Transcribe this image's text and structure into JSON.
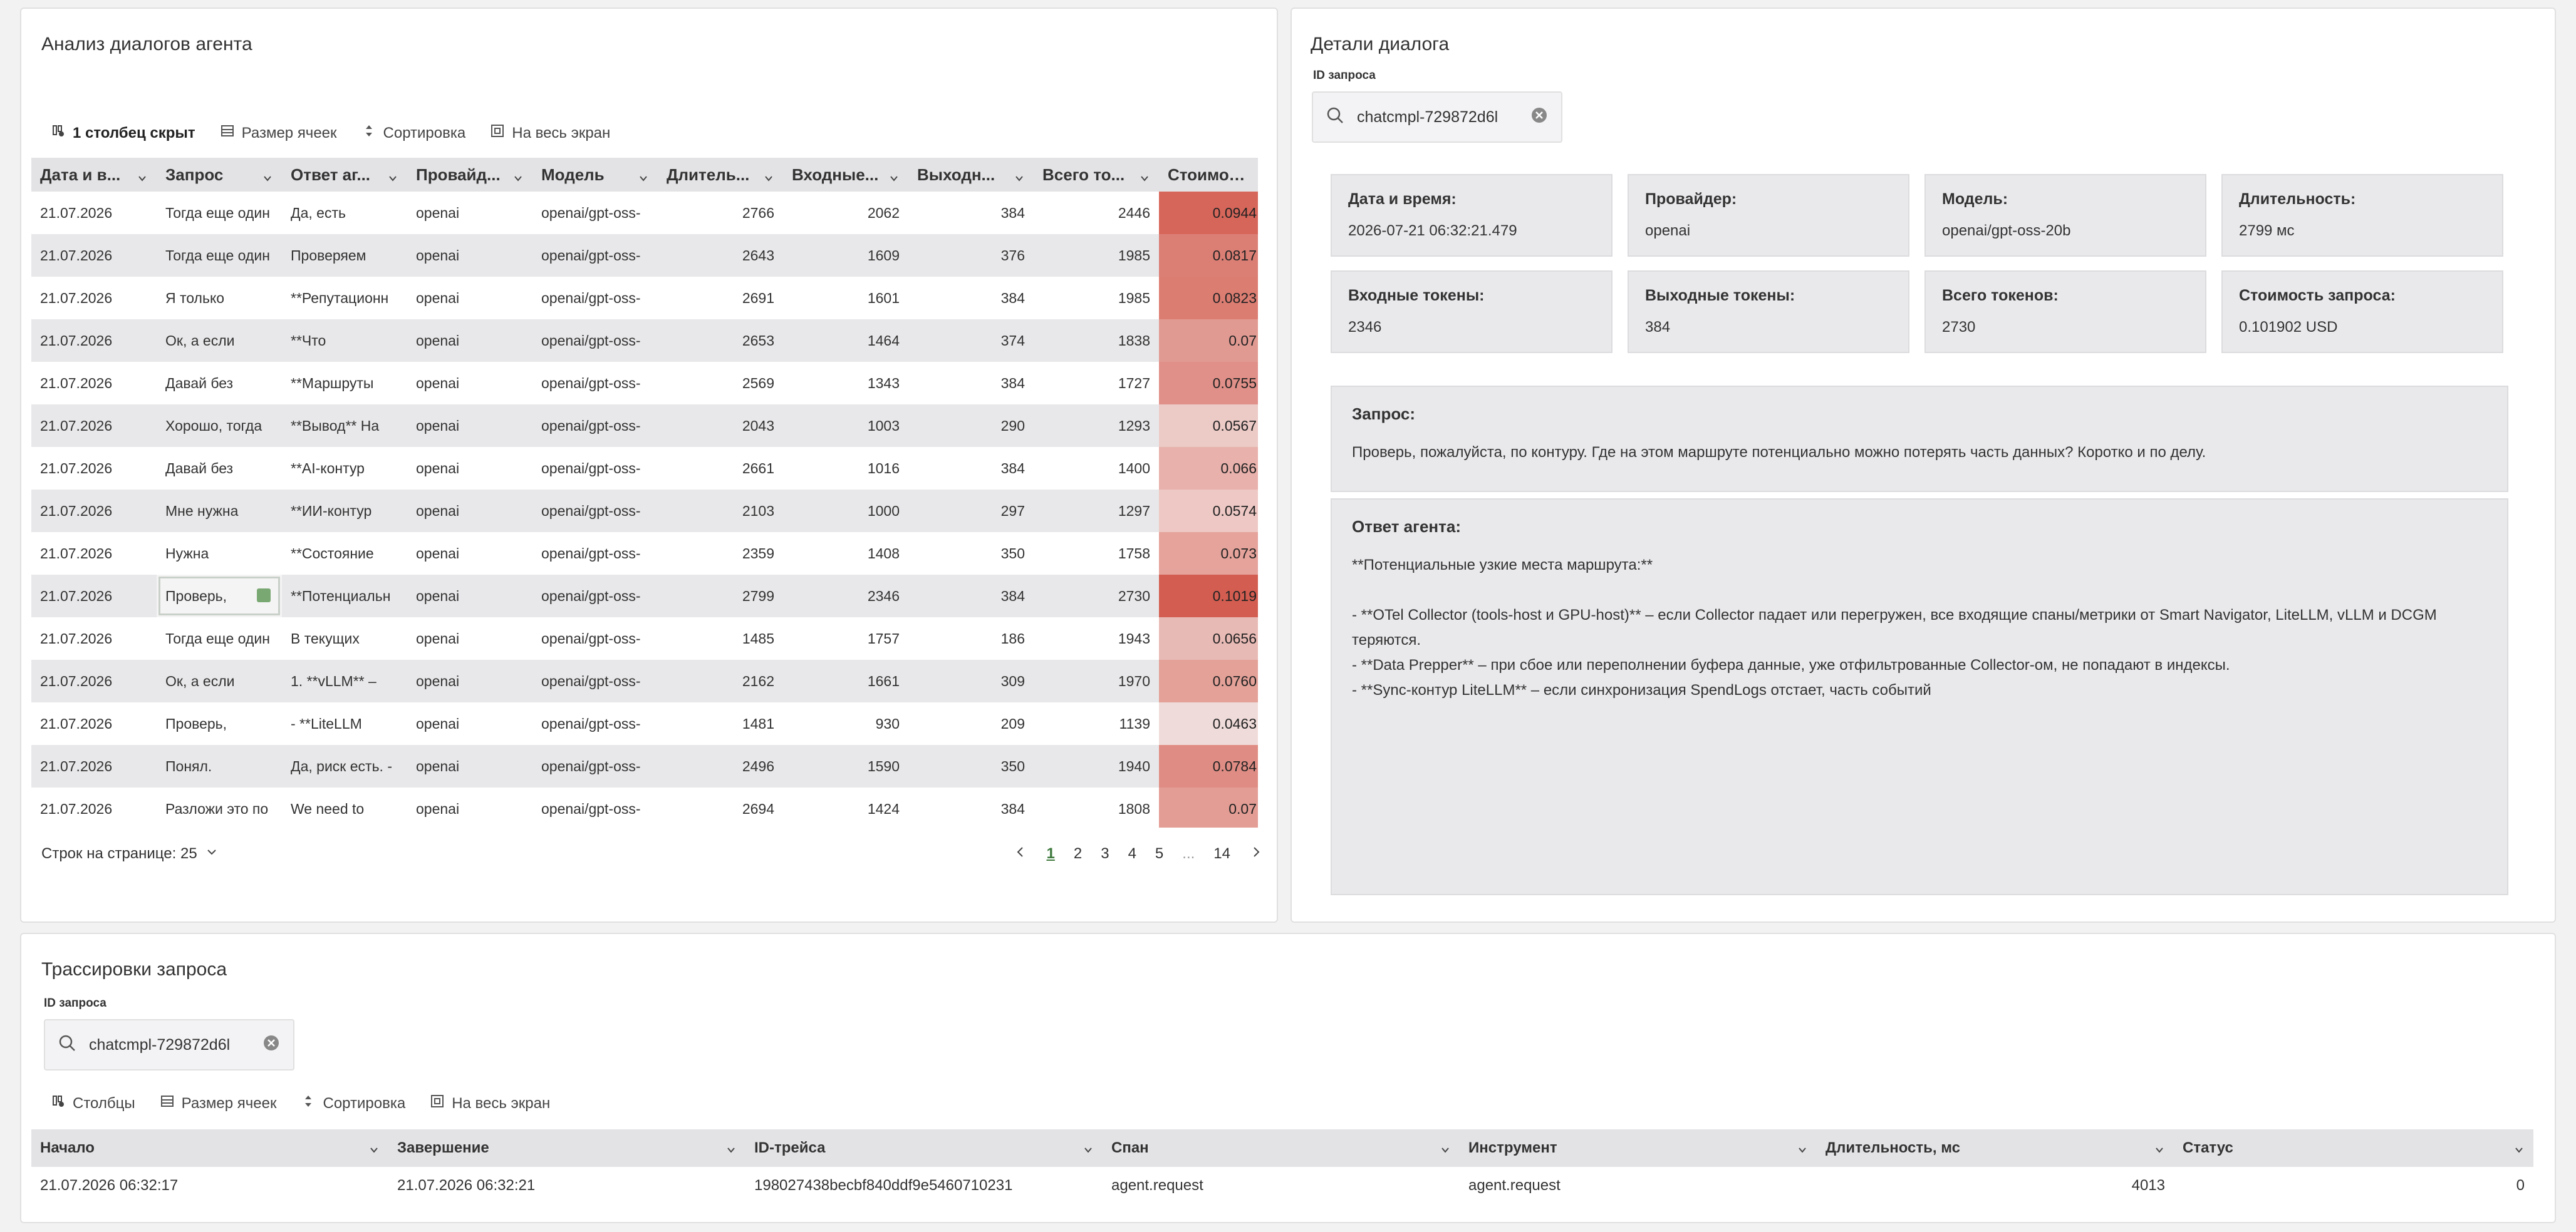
{
  "analysis": {
    "title": "Анализ диалогов агента",
    "toolbar": {
      "hidden_cols": "1 столбец скрыт",
      "cell_size": "Размер ячеек",
      "sort": "Сортировка",
      "fullscreen": "На весь экран"
    },
    "columns": [
      "Дата и в...",
      "Запрос",
      "Ответ аг...",
      "Провайд...",
      "Модель",
      "Длитель...",
      "Входные...",
      "Выходн...",
      "Всего то...",
      "Стоимос..."
    ],
    "rows": [
      [
        "21.07.2026",
        "Тогда еще один",
        "Да, есть",
        "openai",
        "openai/gpt-oss-",
        "2766",
        "2062",
        "384",
        "2446",
        "0.0944"
      ],
      [
        "21.07.2026",
        "Тогда еще один",
        "Проверяем",
        "openai",
        "openai/gpt-oss-",
        "2643",
        "1609",
        "376",
        "1985",
        "0.0817"
      ],
      [
        "21.07.2026",
        "Я только",
        "**Репутационн",
        "openai",
        "openai/gpt-oss-",
        "2691",
        "1601",
        "384",
        "1985",
        "0.0823"
      ],
      [
        "21.07.2026",
        "Ок, а если",
        "**Что",
        "openai",
        "openai/gpt-oss-",
        "2653",
        "1464",
        "374",
        "1838",
        "0.07"
      ],
      [
        "21.07.2026",
        "Давай без",
        "**Маршруты",
        "openai",
        "openai/gpt-oss-",
        "2569",
        "1343",
        "384",
        "1727",
        "0.0755"
      ],
      [
        "21.07.2026",
        "Хорошо, тогда",
        "**Вывод** На",
        "openai",
        "openai/gpt-oss-",
        "2043",
        "1003",
        "290",
        "1293",
        "0.0567"
      ],
      [
        "21.07.2026",
        "Давай без",
        "**AI-контур",
        "openai",
        "openai/gpt-oss-",
        "2661",
        "1016",
        "384",
        "1400",
        "0.066"
      ],
      [
        "21.07.2026",
        "Мне нужна",
        "**ИИ-контур",
        "openai",
        "openai/gpt-oss-",
        "2103",
        "1000",
        "297",
        "1297",
        "0.0574"
      ],
      [
        "21.07.2026",
        "Нужна",
        "**Состояние",
        "openai",
        "openai/gpt-oss-",
        "2359",
        "1408",
        "350",
        "1758",
        "0.073"
      ],
      [
        "21.07.2026",
        "Проверь,",
        "**Потенциальн",
        "openai",
        "openai/gpt-oss-",
        "2799",
        "2346",
        "384",
        "2730",
        "0.1019"
      ],
      [
        "21.07.2026",
        "Тогда еще один",
        "В текущих",
        "openai",
        "openai/gpt-oss-",
        "1485",
        "1757",
        "186",
        "1943",
        "0.0656"
      ],
      [
        "21.07.2026",
        "Ок, а если",
        "1. **vLLM** –",
        "openai",
        "openai/gpt-oss-",
        "2162",
        "1661",
        "309",
        "1970",
        "0.0760"
      ],
      [
        "21.07.2026",
        "Проверь,",
        "- **LiteLLM",
        "openai",
        "openai/gpt-oss-",
        "1481",
        "930",
        "209",
        "1139",
        "0.0463"
      ],
      [
        "21.07.2026",
        "Понял.",
        "Да, риск есть. -",
        "openai",
        "openai/gpt-oss-",
        "2496",
        "1590",
        "350",
        "1940",
        "0.0784"
      ],
      [
        "21.07.2026",
        "Разложи это по",
        "We need to",
        "openai",
        "openai/gpt-oss-",
        "2694",
        "1424",
        "384",
        "1808",
        "0.07"
      ]
    ],
    "cost_colors": [
      "#d7665a",
      "#db7f75",
      "#dc7d72",
      "#e19a92",
      "#e09088",
      "#eccac6",
      "#e8b1ab",
      "#edc8c4",
      "#e5a39b",
      "#d35d50",
      "#e8bab5",
      "#e3a198",
      "#efdcda",
      "#df8d84",
      "#e39d95"
    ],
    "selected_row": 9,
    "footer": {
      "rows_per_page": "Строк на странице: 25",
      "pages": [
        "1",
        "2",
        "3",
        "4",
        "5",
        "...",
        "14"
      ],
      "active_page": "1"
    }
  },
  "details": {
    "title": "Детали диалога",
    "request_id_label": "ID запроса",
    "request_id_value": "chatcmpl-729872d6l",
    "cards": [
      {
        "label": "Дата и время:",
        "value": "2026-07-21 06:32:21.479"
      },
      {
        "label": "Провайдер:",
        "value": "openai"
      },
      {
        "label": "Модель:",
        "value": "openai/gpt-oss-20b"
      },
      {
        "label": "Длительность:",
        "value": "2799 мс"
      },
      {
        "label": "Входные токены:",
        "value": "2346"
      },
      {
        "label": "Выходные токены:",
        "value": "384"
      },
      {
        "label": "Всего токенов:",
        "value": "2730"
      },
      {
        "label": "Стоимость запроса:",
        "value": "0.101902 USD"
      }
    ],
    "request_label": "Запрос:",
    "request_text": "Проверь, пожалуйста, по контуру. Где на этом маршруте потенциально можно потерять часть данных? Коротко и по делу.",
    "answer_label": "Ответ агента:",
    "answer_lines": [
      "**Потенциальные узкие места маршрута:**",
      "",
      "- **OTel Collector (tools-host и GPU-host)** – если Collector падает или перегружен, все входящие спаны/метрики от Smart Navigator, LiteLLM, vLLM и DCGM теряются.",
      "- **Data Prepper** – при сбое или переполнении буфера данные, уже отфильтрованные Collector-ом, не попадают в индексы.",
      "- **Sync-контур LiteLLM** – если синхронизация SpendLogs отстает, часть событий"
    ]
  },
  "traces": {
    "title": "Трассировки запроса",
    "request_id_label": "ID запроса",
    "request_id_value": "chatcmpl-729872d6l",
    "toolbar": {
      "columns": "Столбцы",
      "cell_size": "Размер ячеек",
      "sort": "Сортировка",
      "fullscreen": "На весь экран"
    },
    "columns": [
      "Начало",
      "Завершение",
      "ID-трейса",
      "Спан",
      "Инструмент",
      "Длительность, мс",
      "Статус"
    ],
    "rows": [
      [
        "21.07.2026 06:32:17",
        "21.07.2026 06:32:21",
        "198027438becbf840ddf9e5460710231",
        "agent.request",
        "agent.request",
        "4013",
        "0"
      ]
    ]
  }
}
